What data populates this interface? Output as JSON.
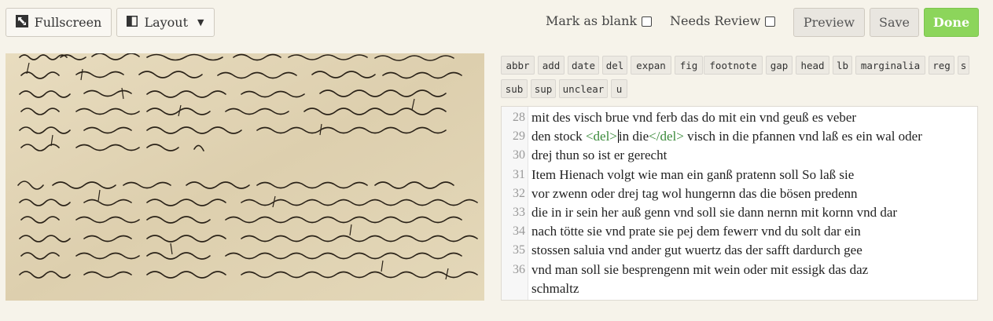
{
  "toolbar": {
    "fullscreen_label": "Fullscreen",
    "layout_label": "Layout",
    "mark_blank_label": "Mark as blank",
    "needs_review_label": "Needs Review",
    "preview_label": "Preview",
    "save_label": "Save",
    "done_label": "Done"
  },
  "tags": [
    "abbr",
    "add",
    "date",
    "del",
    "expan",
    "fig",
    "footnote",
    "gap",
    "head",
    "lb",
    "marginalia",
    "reg",
    "s",
    "sub",
    "sup",
    "unclear",
    "u"
  ],
  "editor": {
    "lines": [
      {
        "num": "28",
        "text": "mit des visch brue vnd ferb das do mit ein vnd geuß es veber"
      },
      {
        "num": "29",
        "pre": "den stock ",
        "open": "<del>",
        "mid_a": "i",
        "mid_b": "n die",
        "close": "</del>",
        "post": " visch in die pfannen vnd laß es ein wal oder"
      },
      {
        "num": "30",
        "text": "drej thun so ist er gerecht"
      },
      {
        "num": "31",
        "text": "Item Hienach volgt wie man ein ganß pratenn soll So laß sie"
      },
      {
        "num": "32",
        "text": "vor zwenn oder drej tag wol hungernn das die bösen predenn"
      },
      {
        "num": "33",
        "text": "die in ir sein her auß genn vnd soll sie dann nernn mit kornn vnd dar"
      },
      {
        "num": "34",
        "text": "nach tötte sie vnd prate sie pej dem fewerr vnd du solt dar ein"
      },
      {
        "num": "35",
        "text": "stossen saluia vnd ander gut wuertz das der safft dardurch gee"
      },
      {
        "num": "36",
        "text": "vnd man soll sie besprengenn mit wein oder mit essigk das daz"
      },
      {
        "num": "",
        "text": "schmaltz"
      }
    ]
  }
}
